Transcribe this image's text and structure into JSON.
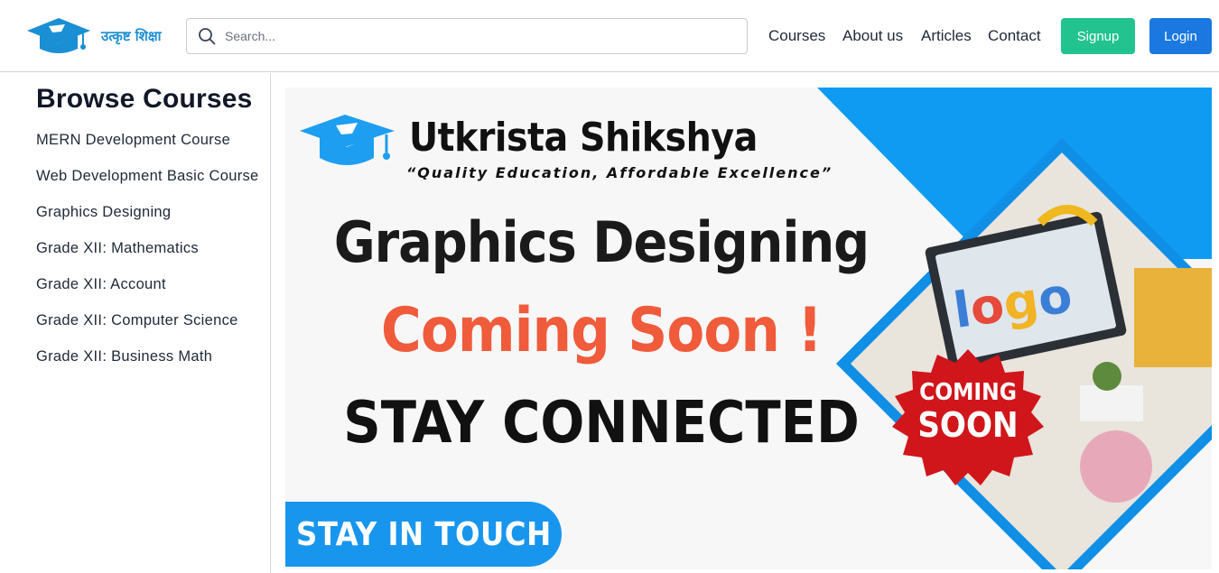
{
  "header": {
    "logo_text": "उत्कृष्ट शिक्षा",
    "search_placeholder": "Search...",
    "nav": [
      "Courses",
      "About us",
      "Articles",
      "Contact"
    ],
    "signup_label": "Signup",
    "login_label": "Login"
  },
  "sidebar": {
    "title": "Browse Courses",
    "courses": [
      "MERN Development Course",
      "Web Development Basic Course",
      "Graphics Designing",
      "Grade XII: Mathematics",
      "Grade XII: Account",
      "Grade XII: Computer Science",
      "Grade XII: Business Math"
    ]
  },
  "banner": {
    "brand_name": "Utkrista Shikshya",
    "tagline": "“Quality Education, Affordable Excellence”",
    "headline_1": "Graphics Designing",
    "headline_2": "Coming Soon !",
    "headline_3": "STAY CONNECTED",
    "burst_line_1": "COMING",
    "burst_line_2": "SOON",
    "cta": "STAY IN TOUCH",
    "screen_word": "logo"
  },
  "colors": {
    "signup": "#22c38e",
    "login": "#1a78e0",
    "brand_blue": "#1896ee",
    "coming_soon_orange": "#ef5b3b",
    "burst_red": "#d0161b"
  }
}
